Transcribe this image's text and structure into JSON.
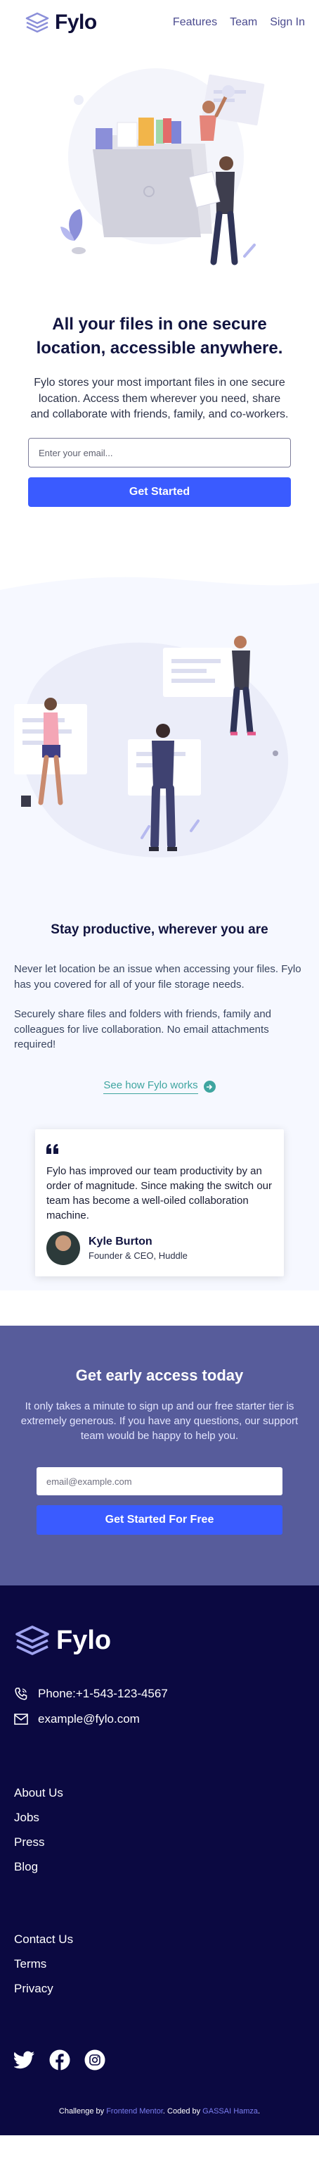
{
  "header": {
    "logo_text": "Fylo",
    "nav": [
      "Features",
      "Team",
      "Sign In"
    ]
  },
  "hero": {
    "title": "All your files in one secure location, accessible anywhere.",
    "text": "Fylo stores your most important files in one secure location. Access them wherever you need, share and collaborate with friends, family, and co-workers.",
    "email_placeholder": "Enter your email...",
    "button_label": "Get Started"
  },
  "productive": {
    "title": "Stay productive, wherever you are",
    "paragraphs": [
      "Never let location be an issue when accessing your files. Fylo has you covered for all of your file storage needs.",
      "Securely share files and folders with friends, family and colleagues for live collaboration. No email attachments required!"
    ],
    "link_text": "See how Fylo works"
  },
  "testimonial": {
    "quote": "Fylo has improved our team productivity by an order of magnitude. Since making the switch our team has become a well-oiled collaboration machine.",
    "name": "Kyle Burton",
    "role": "Founder & CEO, Huddle"
  },
  "early_access": {
    "title": "Get early access today",
    "text": "It only takes a minute to sign up and our free starter tier is extremely generous. If you have any questions, our support team would be happy to help you.",
    "email_placeholder": "email@example.com",
    "button_label": "Get Started For Free"
  },
  "footer": {
    "logo_text": "Fylo",
    "phone": "Phone:+1-543-123-4567",
    "email": "example@fylo.com",
    "links_1": [
      "About Us",
      "Jobs",
      "Press",
      "Blog"
    ],
    "links_2": [
      "Contact Us",
      "Terms",
      "Privacy"
    ],
    "attribution": {
      "prefix": "Challenge by ",
      "fm": "Frontend Mentor",
      "middle": ". Coded by ",
      "author": "GASSAI Hamza",
      "suffix": "."
    }
  },
  "colors": {
    "accent": "#3a5bff",
    "teal": "#3fa5a0",
    "early_bg": "#575c9b",
    "footer_bg": "#0b0941"
  },
  "icons": [
    "fylo-logo-icon",
    "quote-icon",
    "arrow-right-icon",
    "phone-icon",
    "email-icon",
    "twitter-icon",
    "facebook-icon",
    "instagram-icon"
  ]
}
